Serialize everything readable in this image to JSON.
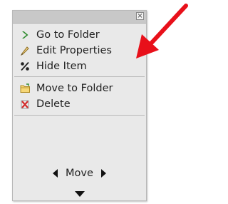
{
  "menu": {
    "close_label": "×",
    "items_group1": [
      {
        "label": "Go to Folder",
        "icon": "green-chevron-right-icon"
      },
      {
        "label": "Edit Properties",
        "icon": "pencil-icon"
      },
      {
        "label": "Hide Item",
        "icon": "percent-hide-icon"
      }
    ],
    "items_group2": [
      {
        "label": "Move to Folder",
        "icon": "folder-icon"
      },
      {
        "label": "Delete",
        "icon": "red-x-icon"
      }
    ],
    "move_label": "Move"
  },
  "colors": {
    "annotation_arrow": "#e8101a",
    "go_icon": "#2e8b2e",
    "delete_icon": "#d22a2a"
  }
}
